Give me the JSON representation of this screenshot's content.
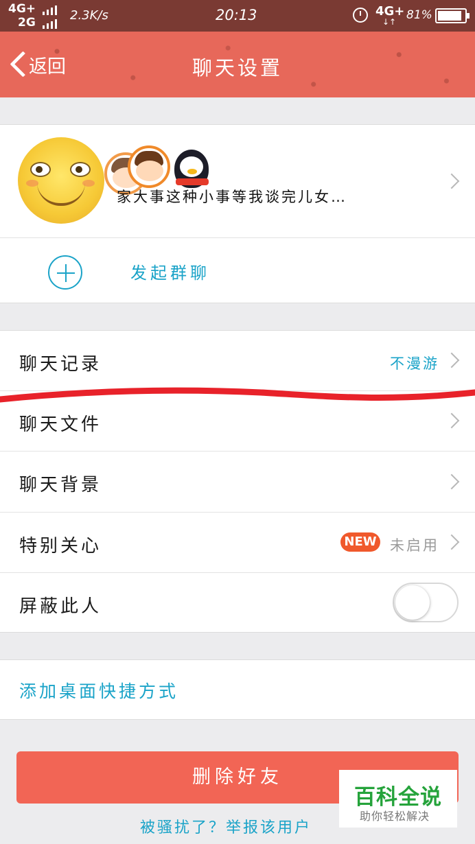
{
  "status_bar": {
    "network_top": "4G+",
    "network_bottom": "2G",
    "speed": "2.3K/s",
    "time": "20:13",
    "network_right": "4G+",
    "arrows": "↓↑",
    "battery": "81%"
  },
  "header": {
    "back_label": "返回",
    "title": "聊天设置"
  },
  "profile": {
    "message": "家大事这种小事等我谈完儿女…"
  },
  "group_chat": {
    "label": "发起群聊"
  },
  "settings": {
    "chat_history": {
      "label": "聊天记录",
      "value": "不漫游"
    },
    "chat_files": {
      "label": "聊天文件"
    },
    "chat_background": {
      "label": "聊天背景"
    },
    "special_care": {
      "label": "特别关心",
      "badge": "NEW",
      "value": "未启用"
    },
    "block": {
      "label": "屏蔽此人",
      "enabled": false
    }
  },
  "shortcut": {
    "label": "添加桌面快捷方式"
  },
  "delete_button": {
    "label": "删除好友"
  },
  "report_link": {
    "label": "被骚扰了？举报该用户"
  },
  "watermark": {
    "main": "百科全说",
    "sub": "助你轻松解决"
  },
  "colors": {
    "header": "#e7685a",
    "accent": "#1aa3c8",
    "danger": "#f26555",
    "badge": "#f0592c",
    "annotation": "#e8222a"
  }
}
